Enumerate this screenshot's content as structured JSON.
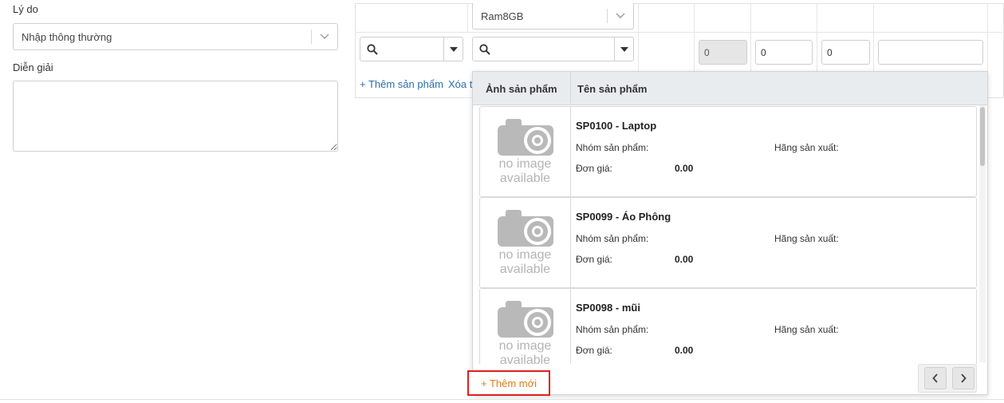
{
  "form": {
    "reason_label": "Lý do",
    "reason_value": "Nhập thông thường",
    "description_label": "Diễn giải",
    "description_value": ""
  },
  "grid": {
    "variant_value": "Ram8GB",
    "qty_disabled": "0",
    "qty1": "0",
    "qty2": "0",
    "note": "",
    "add_product_link": "+ Thêm sản phẩm",
    "delete_link_partial": "Xóa t"
  },
  "popup": {
    "col_image": "Ảnh sản phẩm",
    "col_name": "Tên sản phẩm",
    "no_image_line1": "no image",
    "no_image_line2": "available",
    "group_label": "Nhóm sản phẩm:",
    "maker_label": "Hãng sản xuất:",
    "price_label": "Đơn giá:",
    "products": [
      {
        "title": "SP0100 - Laptop",
        "group": "",
        "maker": "",
        "price": "0.00"
      },
      {
        "title": "SP0099 - Áo Phông",
        "group": "",
        "maker": "",
        "price": "0.00"
      },
      {
        "title": "SP0098 - mũi",
        "group": "",
        "maker": "",
        "price": "0.00"
      }
    ],
    "add_new_label": "+ Thêm mới"
  },
  "colors": {
    "link": "#2a6fb0",
    "add_new_text": "#e07b1a",
    "highlight_border": "#e02020",
    "header_bg": "#e9ecef"
  },
  "icons": [
    "chevron-down-icon",
    "search-icon",
    "caret-down-icon",
    "camera-placeholder-icon",
    "chevron-left-icon",
    "chevron-right-icon"
  ]
}
